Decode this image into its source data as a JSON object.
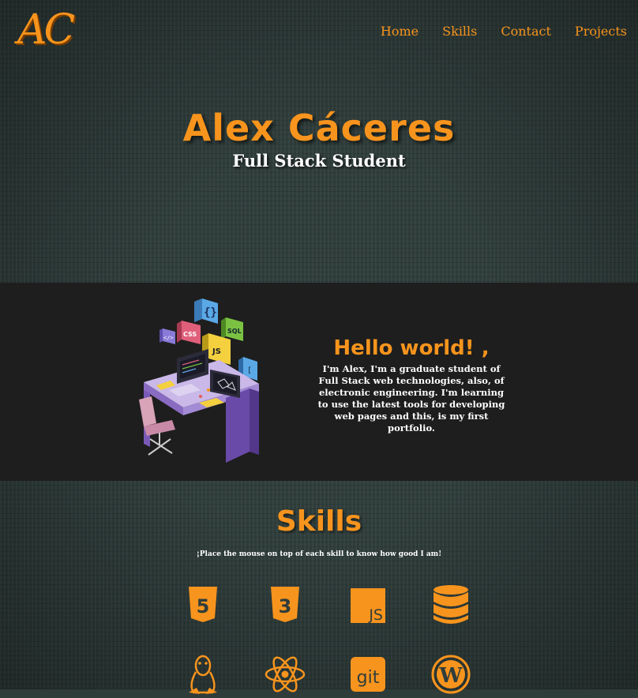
{
  "header": {
    "logo": "AC",
    "nav": [
      "Home",
      "Skills",
      "Contact",
      "Projects"
    ]
  },
  "hero": {
    "name": "Alex Cáceres",
    "role": "Full Stack Student"
  },
  "about": {
    "title": "Hello world! ,",
    "text": "I'm Alex, I'm a graduate student of Full Stack web technologies, also, of electronic engineering. I'm learning to use the latest tools for developing web pages and this, is my first portfolio.",
    "illustration": "desk-developer-illustration"
  },
  "skills": {
    "title": "Skills",
    "hint": "¡Place the mouse on top of each skill to know how good I am!",
    "icons": [
      "html5-icon",
      "css3-icon",
      "javascript-icon",
      "database-icon",
      "linux-icon",
      "react-icon",
      "git-icon",
      "wordpress-icon"
    ],
    "git_text": "git",
    "js_text": "JS",
    "html_text": "5",
    "css_text": "3"
  },
  "colors": {
    "accent": "#f7941d",
    "dark_band": "#1e1e1e",
    "background": "#2f3d3b"
  }
}
